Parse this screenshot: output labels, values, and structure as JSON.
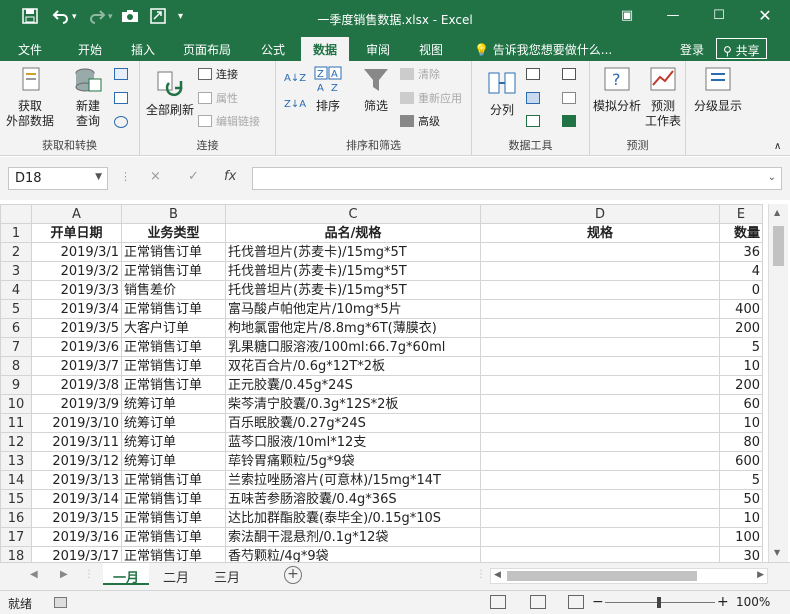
{
  "window": {
    "title": "一季度销售数据.xlsx - Excel",
    "qa_save_icon": "save-icon",
    "qa_undo_icon": "undo-icon",
    "qa_redo_icon": "redo-icon",
    "qa_camera_icon": "camera-icon",
    "qa_custom_icon": "customize-icon"
  },
  "tabs": [
    "文件",
    "开始",
    "插入",
    "页面布局",
    "公式",
    "数据",
    "审阅",
    "视图"
  ],
  "active_tab": "数据",
  "tell_me": "告诉我您想要做什么...",
  "login": "登录",
  "share": "共享",
  "ribbon": {
    "get_transform": {
      "group_label": "获取和转换",
      "get_external_data": "获取\n外部数据",
      "new_query": "新建\n查询"
    },
    "connections": {
      "group_label": "连接",
      "refresh_all": "全部刷新",
      "connections": "连接",
      "properties": "属性",
      "edit_links": "编辑链接"
    },
    "sort_filter": {
      "group_label": "排序和筛选",
      "sort": "排序",
      "filter": "筛选",
      "clear": "清除",
      "reapply": "重新应用",
      "advanced": "高级"
    },
    "data_tools": {
      "group_label": "数据工具",
      "text_to_columns": "分列"
    },
    "forecast": {
      "group_label": "预测",
      "what_if": "模拟分析",
      "forecast_sheet": "预测\n工作表"
    },
    "outline": {
      "outline": "分级显示"
    }
  },
  "formula_bar": {
    "name_box": "D18",
    "cancel_icon": "×",
    "enter_icon": "✓",
    "fx": "fx",
    "value": ""
  },
  "grid": {
    "columns": [
      "A",
      "B",
      "C",
      "D",
      "E"
    ],
    "header_row": [
      "开单日期",
      "业务类型",
      "品名/规格",
      "规格",
      "数量"
    ],
    "rows": [
      [
        "2019/3/1",
        "正常销售订单",
        "托伐普坦片(苏麦卡)/15mg*5T",
        "",
        "36"
      ],
      [
        "2019/3/2",
        "正常销售订单",
        "托伐普坦片(苏麦卡)/15mg*5T",
        "",
        "4"
      ],
      [
        "2019/3/3",
        "销售差价",
        "托伐普坦片(苏麦卡)/15mg*5T",
        "",
        "0"
      ],
      [
        "2019/3/4",
        "正常销售订单",
        "富马酸卢帕他定片/10mg*5片",
        "",
        "400"
      ],
      [
        "2019/3/5",
        "大客户订单",
        "枸地氯雷他定片/8.8mg*6T(薄膜衣)",
        "",
        "200"
      ],
      [
        "2019/3/6",
        "正常销售订单",
        "乳果糖口服溶液/100ml:66.7g*60ml",
        "",
        "5"
      ],
      [
        "2019/3/7",
        "正常销售订单",
        "双花百合片/0.6g*12T*2板",
        "",
        "10"
      ],
      [
        "2019/3/8",
        "正常销售订单",
        "正元胶囊/0.45g*24S",
        "",
        "200"
      ],
      [
        "2019/3/9",
        "统筹订单",
        "柴芩清宁胶囊/0.3g*12S*2板",
        "",
        "60"
      ],
      [
        "2019/3/10",
        "统筹订单",
        "百乐眠胶囊/0.27g*24S",
        "",
        "10"
      ],
      [
        "2019/3/11",
        "统筹订单",
        "蓝芩口服液/10ml*12支",
        "",
        "80"
      ],
      [
        "2019/3/12",
        "统筹订单",
        "荜铃胃痛颗粒/5g*9袋",
        "",
        "600"
      ],
      [
        "2019/3/13",
        "正常销售订单",
        "兰索拉唑肠溶片(可意林)/15mg*14T",
        "",
        "5"
      ],
      [
        "2019/3/14",
        "正常销售订单",
        "五味苦参肠溶胶囊/0.4g*36S",
        "",
        "50"
      ],
      [
        "2019/3/15",
        "正常销售订单",
        "达比加群酯胶囊(泰毕全)/0.15g*10S",
        "",
        "10"
      ],
      [
        "2019/3/16",
        "正常销售订单",
        "索法酮干混悬剂/0.1g*12袋",
        "",
        "100"
      ],
      [
        "2019/3/17",
        "正常销售订单",
        "香芍颗粒/4g*9袋",
        "",
        "30"
      ]
    ]
  },
  "sheet_tabs": [
    "一月",
    "二月",
    "三月"
  ],
  "active_sheet": "一月",
  "status": {
    "ready": "就绪",
    "zoom": "100%",
    "zoom_minus": "−",
    "zoom_plus": "+"
  }
}
